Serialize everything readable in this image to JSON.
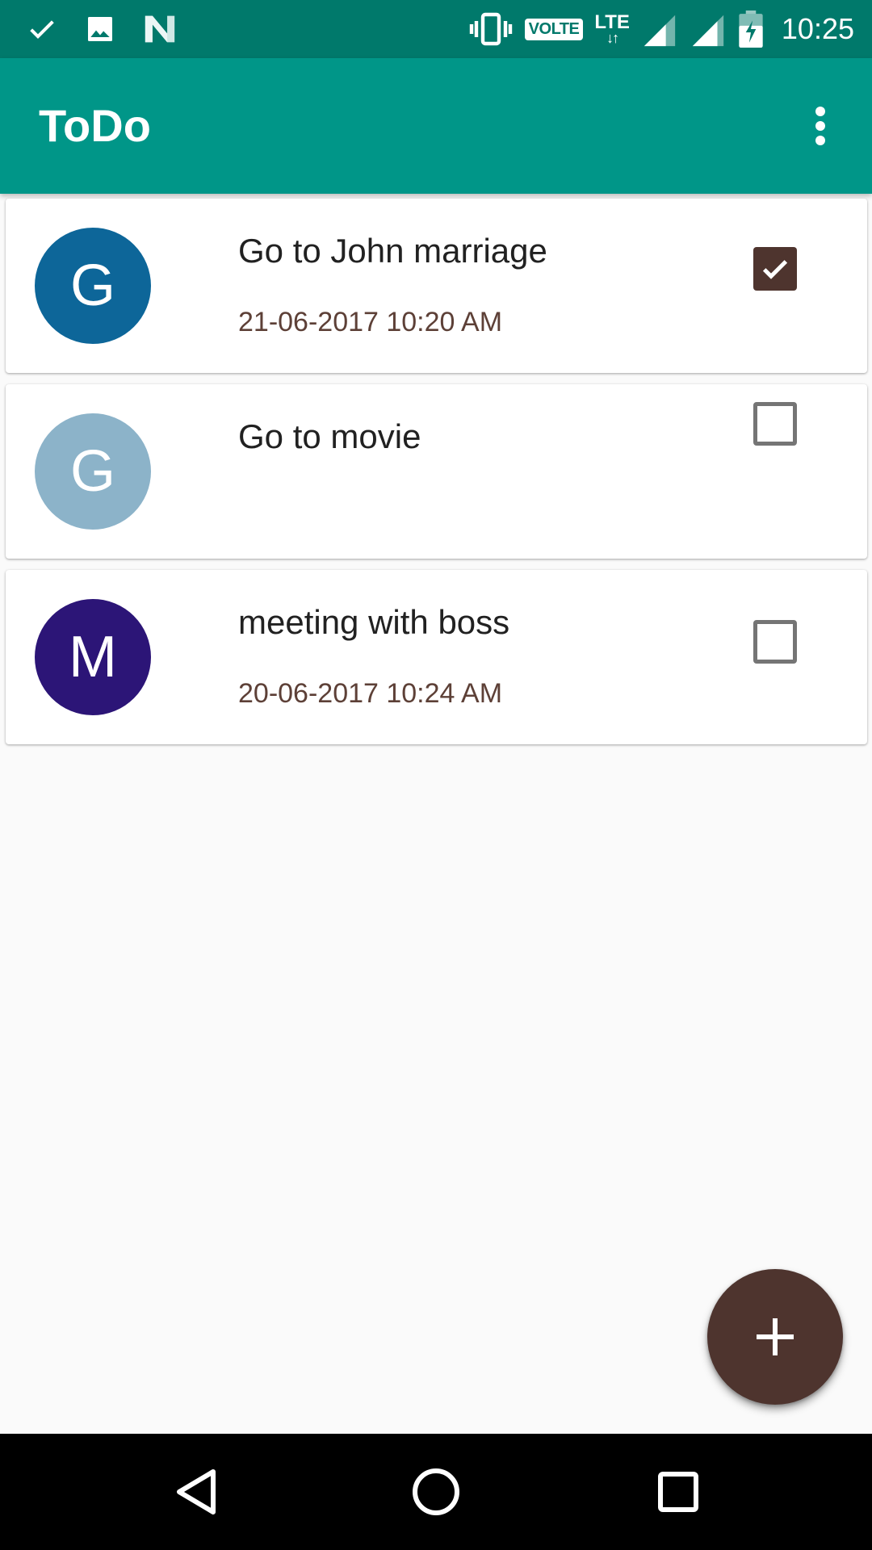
{
  "status_bar": {
    "left_icons": [
      "check-icon",
      "image-icon",
      "n-logo-icon"
    ],
    "right_icons": [
      "vibrate-icon",
      "volte-badge",
      "lte-icon",
      "signal-icon",
      "signal-icon",
      "battery-charging-icon"
    ],
    "volte_label": "VOLTE",
    "lte_label": "LTE",
    "time": "10:25",
    "background": "#00796b"
  },
  "app_bar": {
    "title": "ToDo",
    "background": "#009688",
    "overflow_icon": "more-vert-icon"
  },
  "tasks": [
    {
      "initial": "G",
      "title": "Go to John marriage",
      "date": "21-06-2017 10:20 AM",
      "checked": true,
      "avatar_color": "#0d6699"
    },
    {
      "initial": "G",
      "title": "Go to movie",
      "date": "",
      "checked": false,
      "avatar_color": "#8cb3c9"
    },
    {
      "initial": "M",
      "title": "meeting with boss",
      "date": "20-06-2017 10:24 AM",
      "checked": false,
      "avatar_color": "#2c1577"
    }
  ],
  "fab": {
    "icon": "plus-icon",
    "background": "#4e342e"
  },
  "nav_bar": {
    "buttons": [
      "back-icon",
      "home-icon",
      "recents-icon"
    ]
  },
  "colors": {
    "accent": "#4e342e",
    "date_text": "#5d4037",
    "page_background": "#fafafa"
  }
}
